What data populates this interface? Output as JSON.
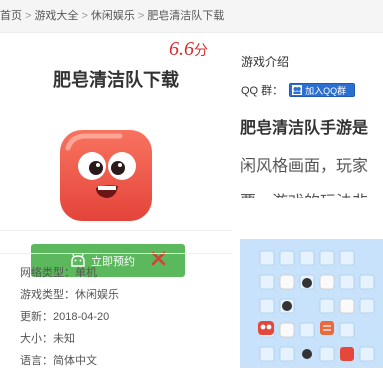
{
  "breadcrumb": {
    "items": [
      "首页",
      "游戏大全",
      "休闲娱乐",
      "肥皂清洁队下载"
    ],
    "separator": ">"
  },
  "game": {
    "rating": "6.6",
    "rating_unit": "分",
    "title": "肥皂清洁队下载",
    "icon": "soap-character-icon"
  },
  "reserve_button": {
    "label": "立即预约",
    "icon": "android-icon",
    "close_icon": "close-icon"
  },
  "info": [
    {
      "label": "网络类型：",
      "value": "单机"
    },
    {
      "label": "游戏类型：",
      "value": "休闲娱乐"
    },
    {
      "label": "更新：",
      "value": "2018-04-20"
    },
    {
      "label": "大小：",
      "value": "未知"
    },
    {
      "label": "语言：",
      "value": "简体中文"
    }
  ],
  "intro": {
    "title": "游戏介绍",
    "qq_label": "QQ 群：",
    "qq_button": "加入QQ群",
    "bold_text": "肥皂清洁队手游是",
    "line2": "闲风格画面，玩家",
    "line3": "要，游戏的玩法非"
  },
  "colors": {
    "accent_red": "#d32f2f",
    "button_green": "#5cb85c",
    "qq_blue": "#2b6fd0"
  }
}
